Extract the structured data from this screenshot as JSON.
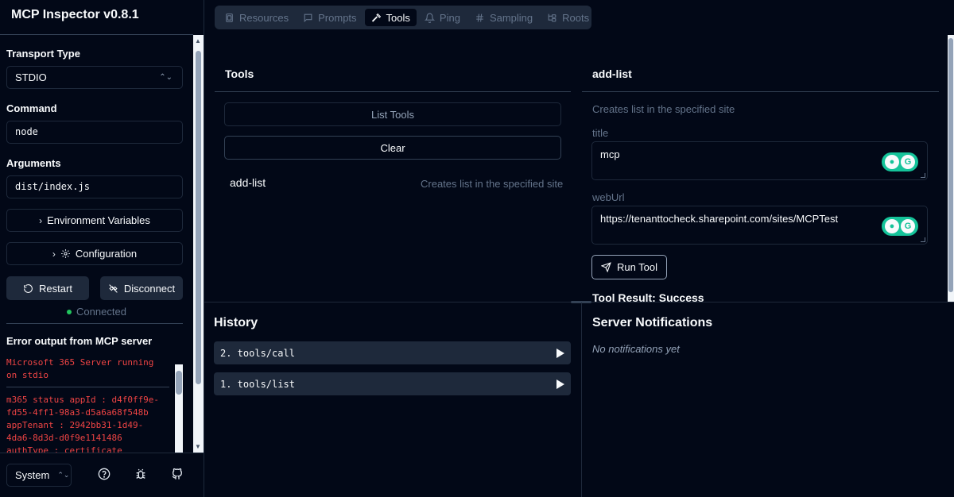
{
  "app": {
    "title": "MCP Inspector v0.8.1"
  },
  "sidebar": {
    "transport_label": "Transport Type",
    "transport_value": "STDIO",
    "command_label": "Command",
    "command_value": "node",
    "arguments_label": "Arguments",
    "arguments_value": "dist/index.js",
    "env_button": "Environment Variables",
    "config_button": "Configuration",
    "restart_button": "Restart",
    "disconnect_button": "Disconnect",
    "status": "Connected",
    "status_color": "#22c55e",
    "error_label": "Error output from MCP server",
    "error_lines": [
      "Microsoft 365 Server running on stdio",
      "m365 status appId : d4f0ff9e-fd55-4ff1-98a3-d5a6a68f548b appTenant : 2942bb31-1d49-4da6-8d3d-d0f9e1141486 authType : certificate cloudType : Public"
    ],
    "theme_value": "System"
  },
  "tabs": [
    "Resources",
    "Prompts",
    "Tools",
    "Ping",
    "Sampling",
    "Roots"
  ],
  "active_tab": "Tools",
  "tools_panel": {
    "title": "Tools",
    "list_button": "List Tools",
    "clear_button": "Clear",
    "tool": {
      "name": "add-list",
      "description": "Creates list in the specified site"
    }
  },
  "detail": {
    "title": "add-list",
    "description": "Creates list in the specified site",
    "params": [
      {
        "label": "title",
        "value": "mcp"
      },
      {
        "label": "webUrl",
        "value": "https://tenanttocheck.sharepoint.com/sites/MCPTest"
      }
    ],
    "run_button": "Run Tool",
    "result_title": "Tool Result: Success"
  },
  "history": {
    "title": "History",
    "items": [
      "2. tools/call",
      "1. tools/list"
    ]
  },
  "notifications": {
    "title": "Server Notifications",
    "empty": "No notifications yet"
  },
  "icons": {
    "tabs": [
      "file-icon",
      "message-icon",
      "hammer-icon",
      "bell-icon",
      "hash-icon",
      "folder-tree-icon"
    ],
    "footer": [
      "help-icon",
      "bug-icon",
      "github-icon"
    ]
  }
}
